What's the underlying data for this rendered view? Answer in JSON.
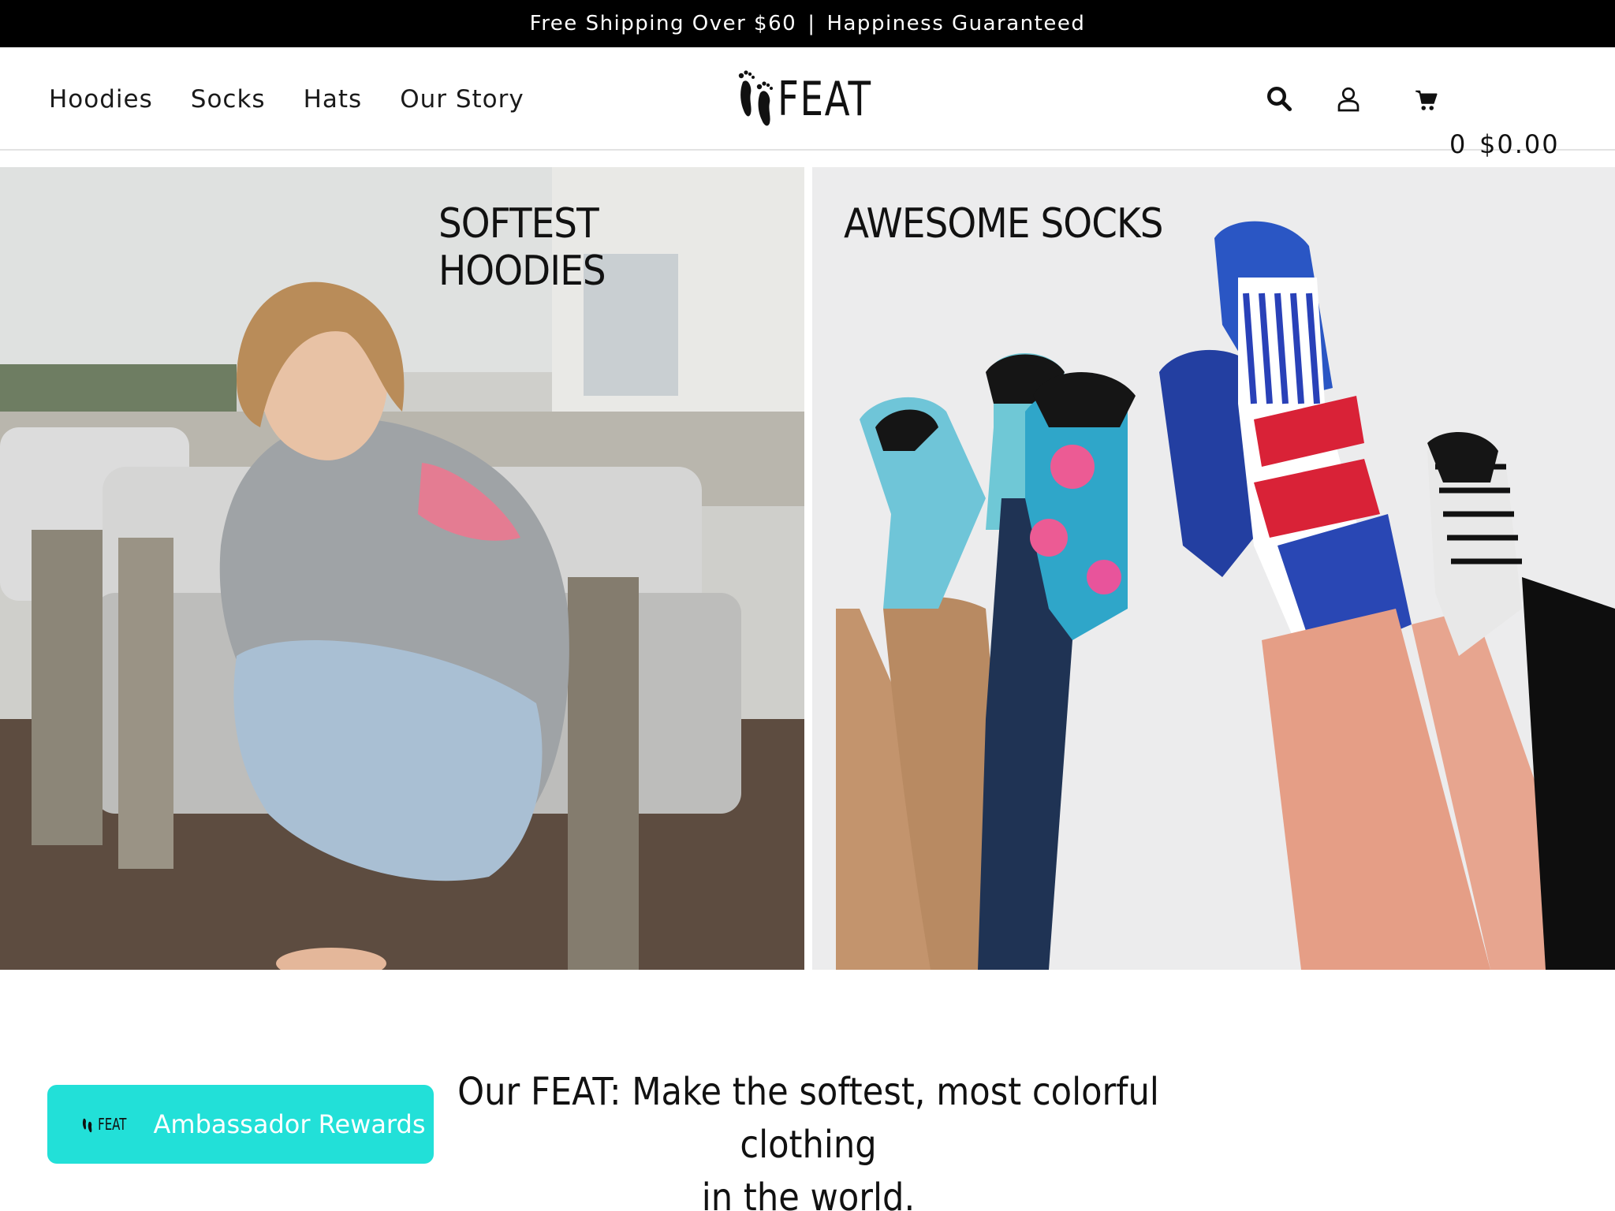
{
  "announcement": {
    "left": "Free Shipping Over $60",
    "separator": "|",
    "right": "Happiness Guaranteed"
  },
  "nav": {
    "items": [
      "Hoodies",
      "Socks",
      "Hats",
      "Our Story"
    ]
  },
  "brand": {
    "name": "FEAT"
  },
  "header_icons": {
    "search": "search-icon",
    "account": "user-icon",
    "cart": "cart-icon"
  },
  "cart": {
    "count": "0",
    "total": "$0.00"
  },
  "promos": [
    {
      "title": "SOFTEST HOODIES"
    },
    {
      "title": "AWESOME SOCKS"
    }
  ],
  "mission": {
    "line1": "Our FEAT: Make the softest, most colorful clothing",
    "line2": "in the world."
  },
  "rewards": {
    "brand": "FEAT",
    "label": "Ambassador Rewards"
  },
  "colors": {
    "announcement_bg": "#000000",
    "rewards_bg": "#22e0d8",
    "text": "#111111"
  }
}
